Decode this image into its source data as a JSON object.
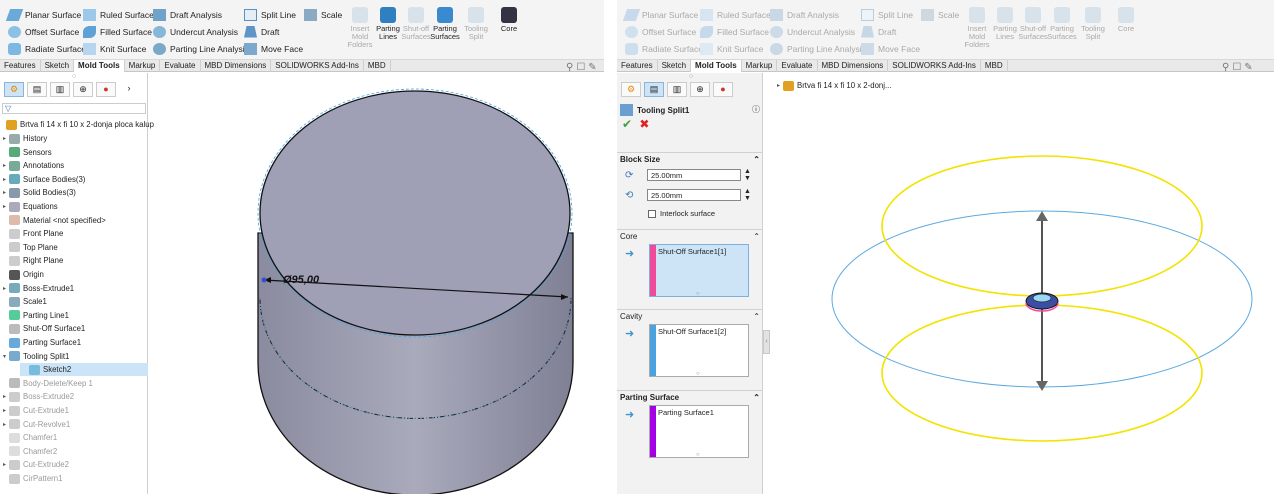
{
  "ribbon": {
    "col1": [
      "Planar Surface",
      "Offset Surface",
      "Radiate Surface"
    ],
    "col2": [
      "Ruled Surface",
      "Filled Surface",
      "Knit Surface"
    ],
    "col3": [
      "Draft Analysis",
      "Undercut Analysis",
      "Parting Line Analysis"
    ],
    "col4": [
      "Split Line",
      "Draft",
      "Move Face"
    ],
    "scale": "Scale",
    "big": [
      {
        "label": "Insert Mold Folders",
        "enabled": false
      },
      {
        "label": "Parting Lines",
        "enabled": true
      },
      {
        "label": "Shut-off Surfaces",
        "enabled": false
      },
      {
        "label": "Parting Surfaces",
        "enabled": true
      },
      {
        "label": "Tooling Split",
        "enabled": false
      },
      {
        "label": "Core",
        "enabled": true
      }
    ]
  },
  "tabs": [
    "Features",
    "Sketch",
    "Mold Tools",
    "Markup",
    "Evaluate",
    "MBD Dimensions",
    "SOLIDWORKS Add-Ins",
    "MBD"
  ],
  "active_tab": "Mold Tools",
  "tree": {
    "part_name": "Brtva fi 14 x fi 10 x 2-donja ploca kalup",
    "items": [
      {
        "label": "History",
        "exp": true,
        "gray": false
      },
      {
        "label": "Sensors",
        "exp": false,
        "gray": false
      },
      {
        "label": "Annotations",
        "exp": true,
        "gray": false
      },
      {
        "label": "Surface Bodies(3)",
        "exp": true,
        "gray": false
      },
      {
        "label": "Solid Bodies(3)",
        "exp": true,
        "gray": false
      },
      {
        "label": "Equations",
        "exp": true,
        "gray": false
      },
      {
        "label": "Material <not specified>",
        "exp": false,
        "gray": false
      },
      {
        "label": "Front Plane",
        "exp": false,
        "gray": false
      },
      {
        "label": "Top Plane",
        "exp": false,
        "gray": false
      },
      {
        "label": "Right Plane",
        "exp": false,
        "gray": false
      },
      {
        "label": "Origin",
        "exp": false,
        "gray": false
      },
      {
        "label": "Boss-Extrude1",
        "exp": true,
        "gray": false
      },
      {
        "label": "Scale1",
        "exp": false,
        "gray": false
      },
      {
        "label": "Parting Line1",
        "exp": false,
        "gray": false
      },
      {
        "label": "Shut-Off Surface1",
        "exp": false,
        "gray": false
      },
      {
        "label": "Parting Surface1",
        "exp": false,
        "gray": false
      },
      {
        "label": "Tooling Split1",
        "exp": true,
        "gray": false
      },
      {
        "label": "Sketch2",
        "exp": false,
        "gray": false
      },
      {
        "label": "Body-Delete/Keep 1",
        "exp": false,
        "gray": true
      },
      {
        "label": "Boss-Extrude2",
        "exp": true,
        "gray": true
      },
      {
        "label": "Cut-Extrude1",
        "exp": true,
        "gray": true
      },
      {
        "label": "Cut-Revolve1",
        "exp": true,
        "gray": true
      },
      {
        "label": "Chamfer1",
        "exp": false,
        "gray": true
      },
      {
        "label": "Chamfer2",
        "exp": false,
        "gray": true
      },
      {
        "label": "Cut-Extrude2",
        "exp": true,
        "gray": true
      },
      {
        "label": "CirPattern1",
        "exp": false,
        "gray": true
      }
    ]
  },
  "dimension_label": "Ø95,00",
  "right_tree_part": "Brtva fi 14 x fi 10 x 2-donj...",
  "pm": {
    "title": "Tooling Split1",
    "block_size_label": "Block Size",
    "depth1": "25.00mm",
    "depth2": "25.00mm",
    "interlock_label": "Interlock surface",
    "core_label": "Core",
    "core_item": "Shut-Off Surface1[1]",
    "cavity_label": "Cavity",
    "cavity_item": "Shut-Off Surface1[2]",
    "parting_label": "Parting Surface",
    "parting_item": "Parting Surface1"
  },
  "colors": {
    "part_gray": "#9a9bb0",
    "accent_blue": "#4aa3df",
    "core_pink": "#f04a9b",
    "cavity_blue": "#4aa3df",
    "parting_purple": "#a300e6",
    "yellow_ring": "#f2e300"
  }
}
